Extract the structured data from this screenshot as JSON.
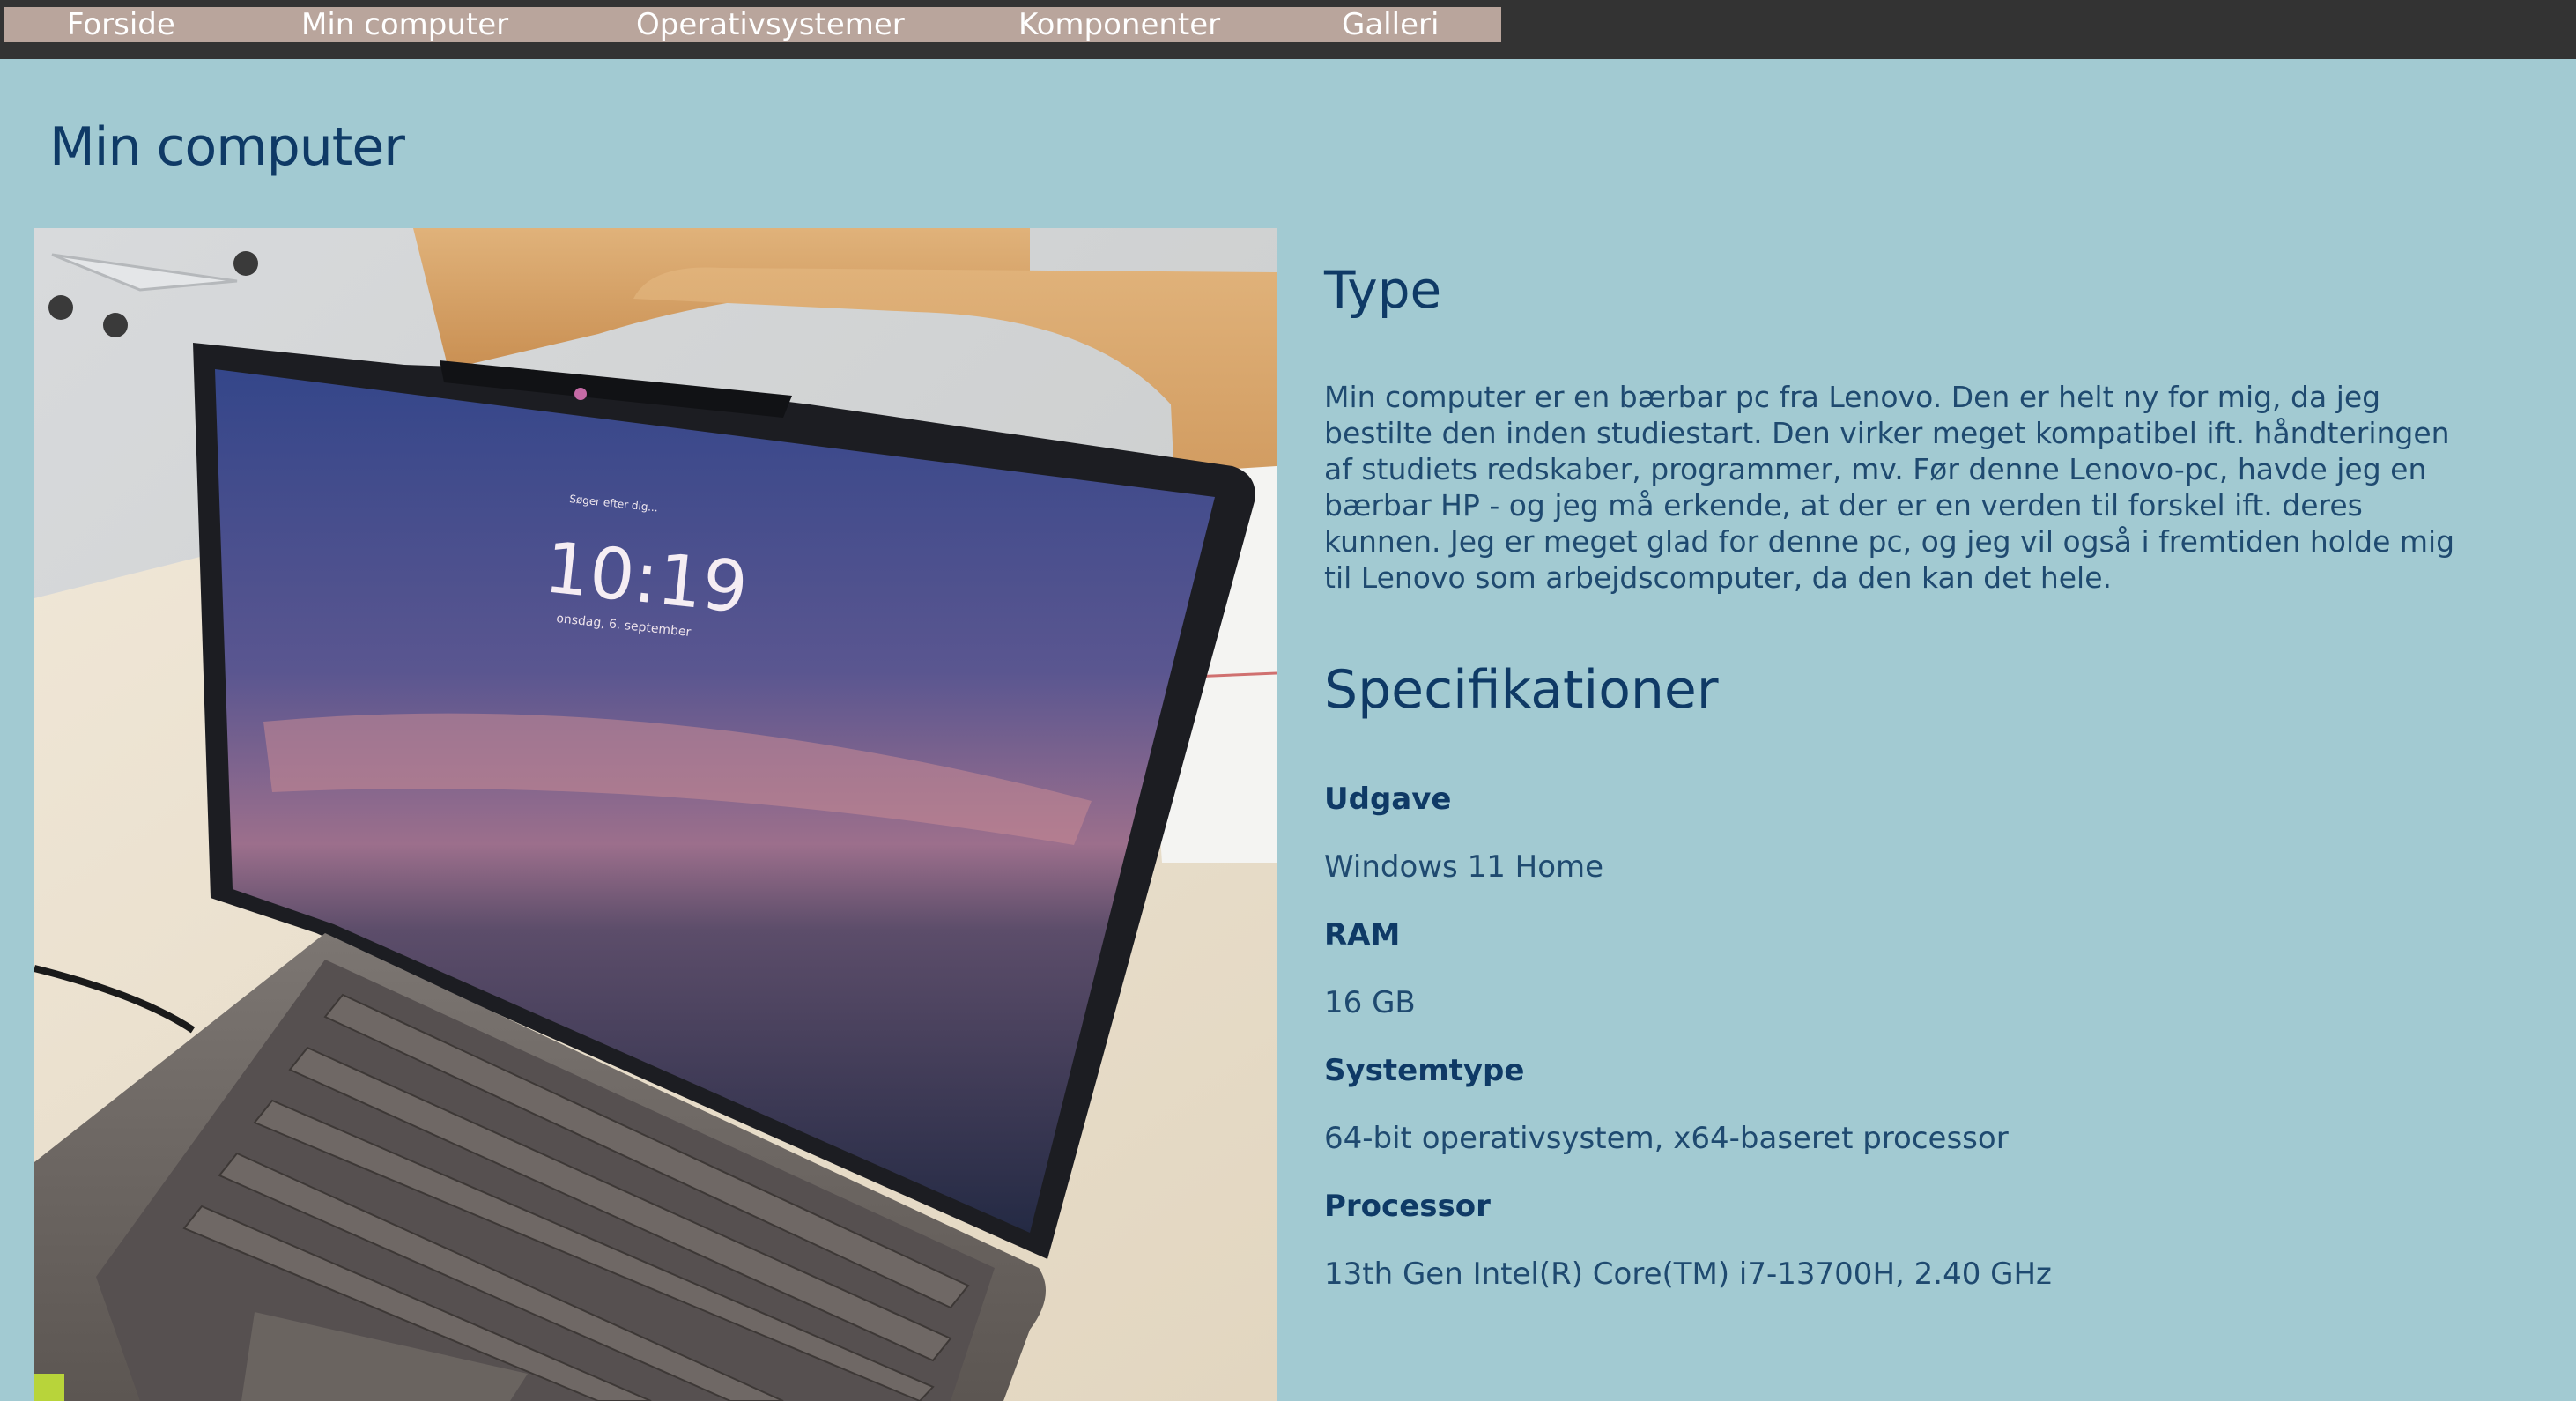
{
  "nav": {
    "items": [
      {
        "label": "Forside"
      },
      {
        "label": "Min computer"
      },
      {
        "label": "Operativsystemer"
      },
      {
        "label": "Komponenter"
      },
      {
        "label": "Galleri"
      }
    ]
  },
  "page": {
    "title": "Min computer"
  },
  "photo": {
    "screen_time": "10:19",
    "screen_prompt": "Søger efter dig...",
    "screen_date": "onsdag, 6. september"
  },
  "type_section": {
    "heading": "Type",
    "text": "Min computer er en bærbar pc fra Lenovo. Den er helt ny for mig, da jeg bestilte den inden studiestart. Den virker meget kompatibel ift. håndteringen af studiets redskaber, programmer, mv. Før denne Lenovo-pc, havde jeg en bærbar HP - og jeg må erkende, at der er en verden til forskel ift. deres kunnen. Jeg er meget glad for denne pc, og jeg vil også i fremtiden holde mig til Lenovo som arbejdscomputer, da den kan det hele."
  },
  "specs_section": {
    "heading": "Specifikationer",
    "items": [
      {
        "label": "Udgave",
        "value": "Windows 11 Home"
      },
      {
        "label": "RAM",
        "value": "16 GB"
      },
      {
        "label": "Systemtype",
        "value": "64-bit operativsystem, x64-baseret processor"
      },
      {
        "label": "Processor",
        "value": "13th Gen Intel(R) Core(TM) i7-13700H, 2.40 GHz"
      }
    ]
  },
  "colors": {
    "page_background": "#a2cad2",
    "topbar": "#333333",
    "nav_background": "#b9a59c",
    "heading": "#0f3a66",
    "body_text": "#1f4a70"
  }
}
